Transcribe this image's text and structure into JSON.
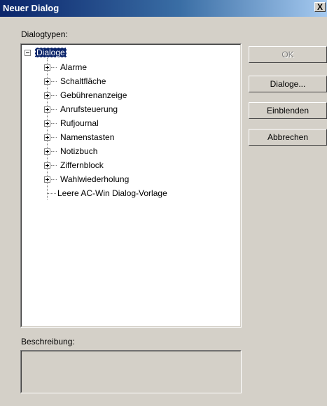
{
  "window": {
    "title": "Neuer Dialog",
    "close_label": "X"
  },
  "labels": {
    "dialog_types": "Dialogtypen:",
    "description": "Beschreibung:"
  },
  "buttons": {
    "ok": "OK",
    "dialoge": "Dialoge...",
    "einblenden": "Einblenden",
    "abbrechen": "Abbrechen"
  },
  "tree": {
    "root": "Dialoge",
    "items": [
      "Alarme",
      "Schaltfläche",
      "Gebührenanzeige",
      "Anrufsteuerung",
      "Rufjournal",
      "Namenstasten",
      "Notizbuch",
      "Ziffernblock",
      "Wahlwiederholung"
    ],
    "leaf": "Leere AC-Win Dialog-Vorlage"
  }
}
